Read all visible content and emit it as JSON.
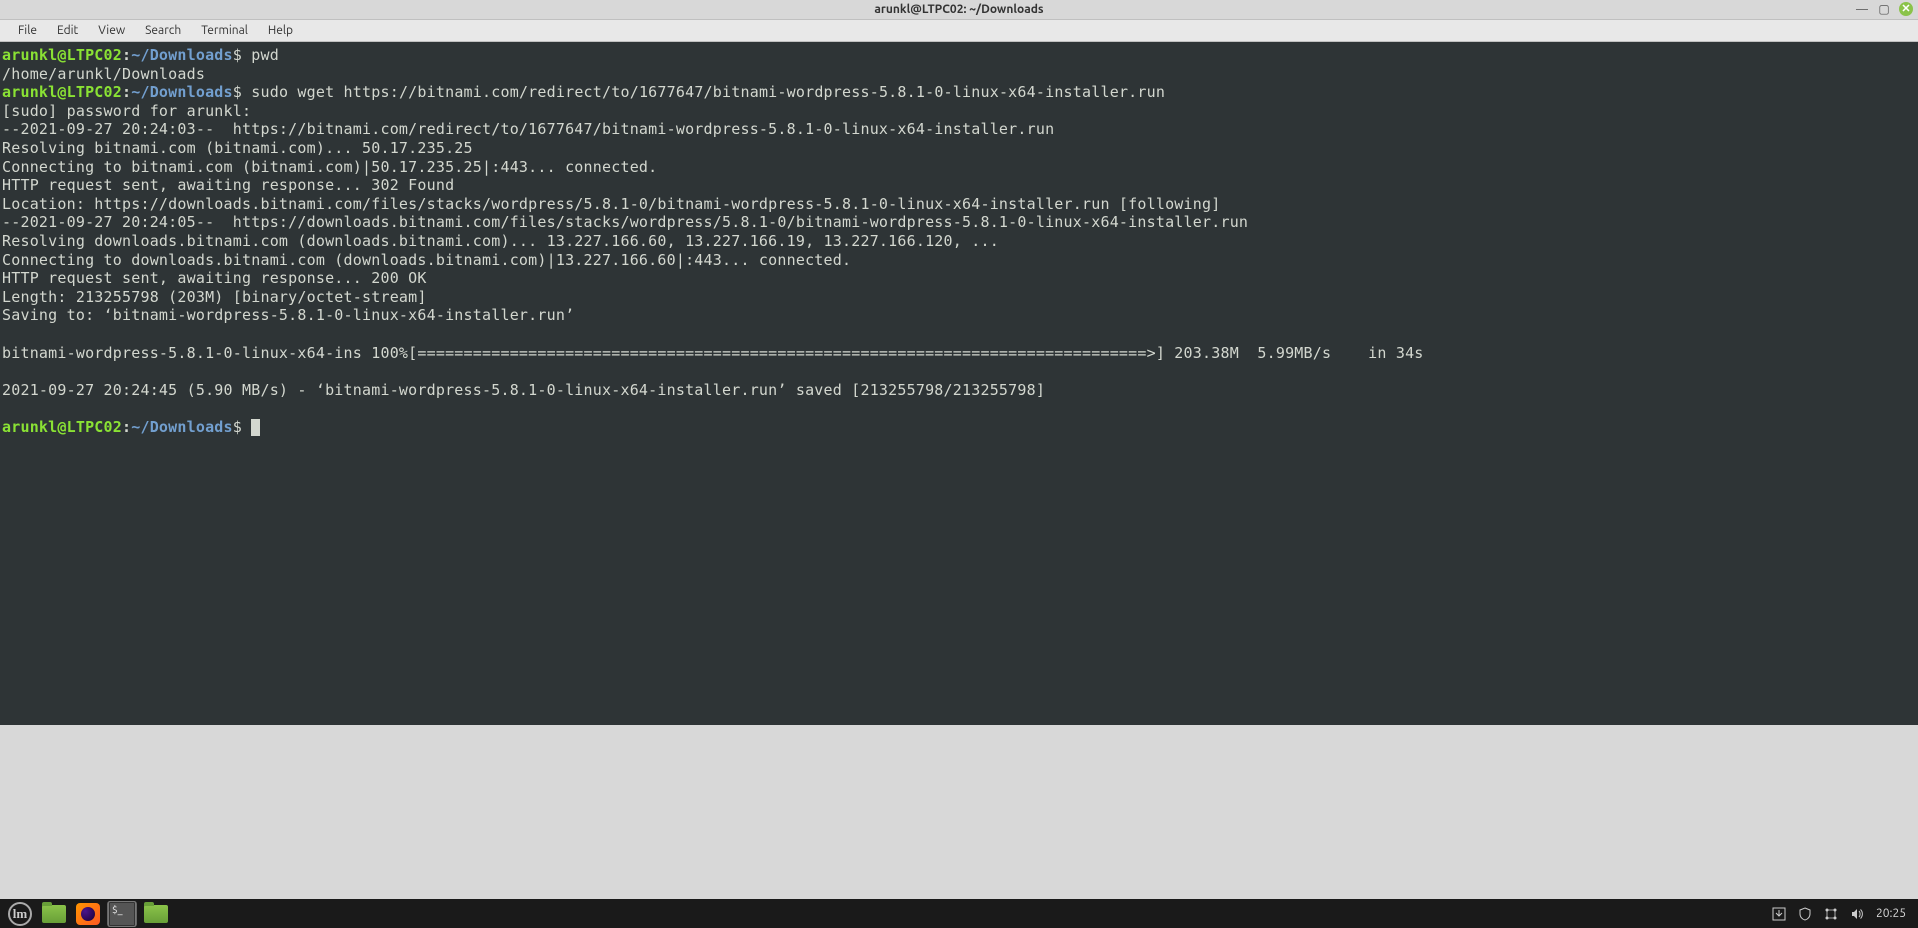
{
  "window": {
    "title": "arunkl@LTPC02: ~/Downloads"
  },
  "menubar": {
    "items": [
      "File",
      "Edit",
      "View",
      "Search",
      "Terminal",
      "Help"
    ]
  },
  "prompt": {
    "user": "arunkl@LTPC02",
    "colon": ":",
    "path": "~/Downloads",
    "symbol": "$"
  },
  "terminal": {
    "lines": [
      {
        "type": "prompt",
        "cmd": "pwd"
      },
      {
        "type": "out",
        "text": "/home/arunkl/Downloads"
      },
      {
        "type": "prompt",
        "cmd": "sudo wget https://bitnami.com/redirect/to/1677647/bitnami-wordpress-5.8.1-0-linux-x64-installer.run"
      },
      {
        "type": "out",
        "text": "[sudo] password for arunkl:"
      },
      {
        "type": "out",
        "text": "--2021-09-27 20:24:03--  https://bitnami.com/redirect/to/1677647/bitnami-wordpress-5.8.1-0-linux-x64-installer.run"
      },
      {
        "type": "out",
        "text": "Resolving bitnami.com (bitnami.com)... 50.17.235.25"
      },
      {
        "type": "out",
        "text": "Connecting to bitnami.com (bitnami.com)|50.17.235.25|:443... connected."
      },
      {
        "type": "out",
        "text": "HTTP request sent, awaiting response... 302 Found"
      },
      {
        "type": "out",
        "text": "Location: https://downloads.bitnami.com/files/stacks/wordpress/5.8.1-0/bitnami-wordpress-5.8.1-0-linux-x64-installer.run [following]"
      },
      {
        "type": "out",
        "text": "--2021-09-27 20:24:05--  https://downloads.bitnami.com/files/stacks/wordpress/5.8.1-0/bitnami-wordpress-5.8.1-0-linux-x64-installer.run"
      },
      {
        "type": "out",
        "text": "Resolving downloads.bitnami.com (downloads.bitnami.com)... 13.227.166.60, 13.227.166.19, 13.227.166.120, ..."
      },
      {
        "type": "out",
        "text": "Connecting to downloads.bitnami.com (downloads.bitnami.com)|13.227.166.60|:443... connected."
      },
      {
        "type": "out",
        "text": "HTTP request sent, awaiting response... 200 OK"
      },
      {
        "type": "out",
        "text": "Length: 213255798 (203M) [binary/octet-stream]"
      },
      {
        "type": "out",
        "text": "Saving to: ‘bitnami-wordpress-5.8.1-0-linux-x64-installer.run’"
      },
      {
        "type": "blank"
      },
      {
        "type": "out",
        "text": "bitnami-wordpress-5.8.1-0-linux-x64-ins 100%[===============================================================================>] 203.38M  5.99MB/s    in 34s"
      },
      {
        "type": "blank"
      },
      {
        "type": "out",
        "text": "2021-09-27 20:24:45 (5.90 MB/s) - ‘bitnami-wordpress-5.8.1-0-linux-x64-installer.run’ saved [213255798/213255798]"
      },
      {
        "type": "blank"
      },
      {
        "type": "prompt",
        "cmd": "",
        "cursor": true
      }
    ]
  },
  "taskbar": {
    "mint_label": "lm",
    "terminal_glyph": "$_",
    "clock": "20:25"
  },
  "tray": {
    "update": "⇩",
    "shield": "⛨",
    "network": "⬚",
    "volume": "🔊"
  },
  "window_controls": {
    "minimize": "—",
    "maximize": "▢",
    "close": "✕"
  }
}
